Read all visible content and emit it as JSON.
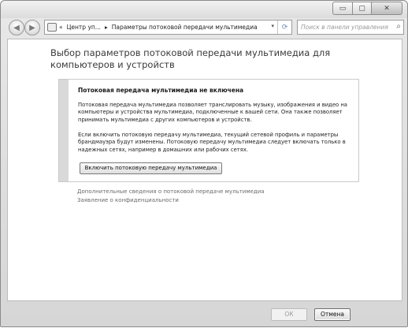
{
  "window": {
    "caption": {
      "minimize_glyph": "▭",
      "maximize_glyph": "▢",
      "close_glyph": "✕"
    }
  },
  "navbar": {
    "back_glyph": "◀",
    "forward_glyph": "▶",
    "address": {
      "prefix": "«",
      "segment1": "Центр уп...",
      "separator": "▸",
      "segment2": "Параметры потоковой передачи мультимедиа",
      "dropdown_glyph": "▾",
      "refresh_glyph": "⟳"
    },
    "search": {
      "placeholder": "Поиск в панели управления",
      "icon_glyph": "⌕"
    }
  },
  "main": {
    "title": "Выбор параметров потоковой передачи мультимедиа для компьютеров и устройств",
    "panel": {
      "heading": "Потоковая передача мультимедиа не включена",
      "paragraph1": "Потоковая передача мультимедиа позволяет транслировать музыку, изображения и видео на компьютеры и устройства мультимедиа, подключенные к вашей сети. Она также позволяет принимать мультимедиа с других компьютеров и устройств.",
      "paragraph2": "Если включить потоковую передачу мультимедиа, текущий сетевой профиль и параметры брандмауэра будут изменены. Потоковую передачу мультимедиа следует включать только в надежных сетях, например в домашних или рабочих сетях.",
      "enable_button": "Включить потоковую передачу мультимедиа"
    },
    "links": {
      "more_info": "Дополнительные сведения о потоковой передаче мультимедиа",
      "privacy": "Заявление о конфиденциальности"
    }
  },
  "footer": {
    "ok_label": "ОК",
    "cancel_label": "Отмена"
  },
  "colors": {
    "panel_accent": "#d9d9d9",
    "link": "#6b6b6b",
    "window_frame": "#dcdcdc"
  }
}
